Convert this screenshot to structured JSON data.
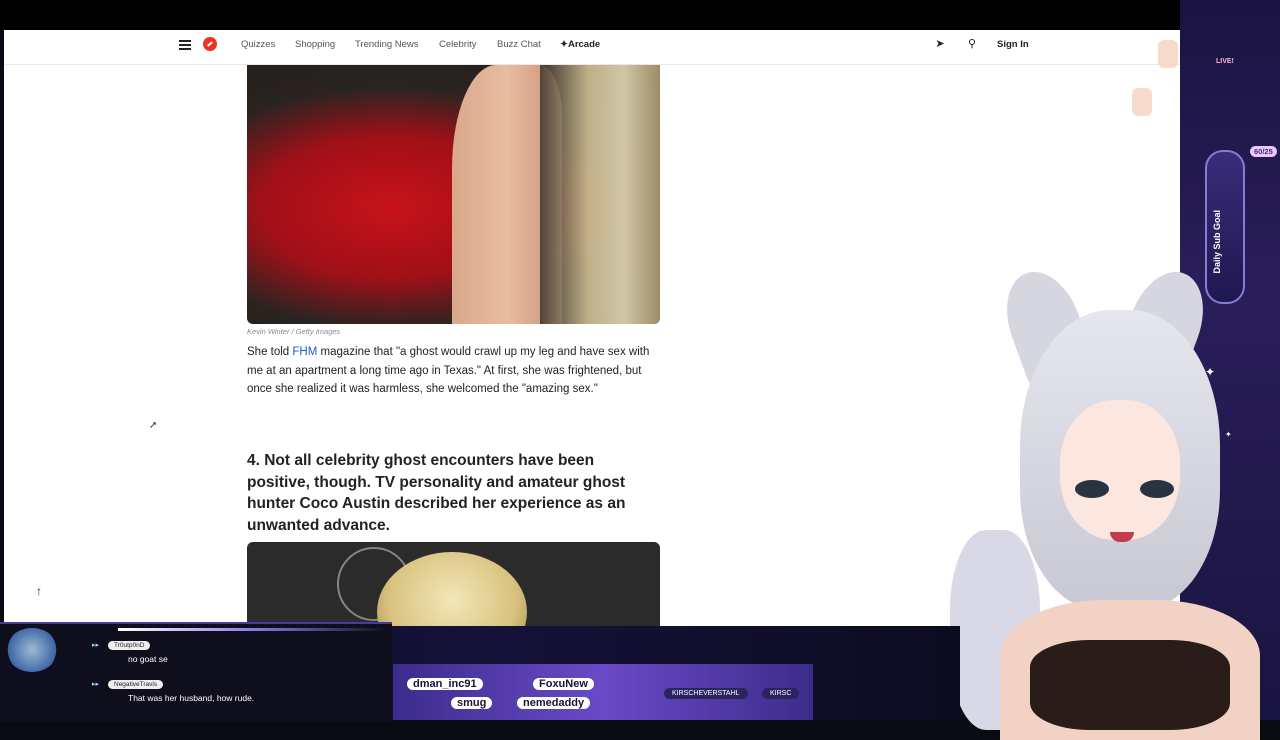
{
  "nav": {
    "links": [
      "Quizzes",
      "Shopping",
      "Trending News",
      "Celebrity",
      "Buzz Chat"
    ],
    "arcade": "Arcade",
    "sign_in": "Sign In"
  },
  "article": {
    "caption": "Kevin Winter / Getty Images",
    "para_before": "She told ",
    "para_link": "FHM",
    "para_after": " magazine that \"a ghost would crawl up my leg and have sex with me at an apartment a long time ago in Texas.\" At first, she was frightened, but once she realized it was harmless, she welcomed the \"amazing sex.\"",
    "heading": "4. Not all celebrity ghost encounters have been positive, though. TV personality and amateur ghost hunter Coco Austin described her experience as an unwanted advance."
  },
  "stream": {
    "live": "LIVE!",
    "goal_label": "Daily Sub Goal",
    "goal_count": "60/25",
    "chat": [
      {
        "user": "Tr0utp0nD",
        "message": "no goat se"
      },
      {
        "user": "NegativeTravis",
        "message": "That was her husband, how rude."
      }
    ],
    "ticker_names": [
      "dman_inc91",
      "FoxuNew",
      "smug",
      "nemedaddy"
    ],
    "socials": [
      "KIRSCHEVERSTAHL",
      "KIRSC"
    ]
  },
  "icons": [
    "menu-icon",
    "logo-icon",
    "sparkle-icon",
    "send-icon",
    "search-icon",
    "arrow-up-icon",
    "cursor-icon"
  ]
}
